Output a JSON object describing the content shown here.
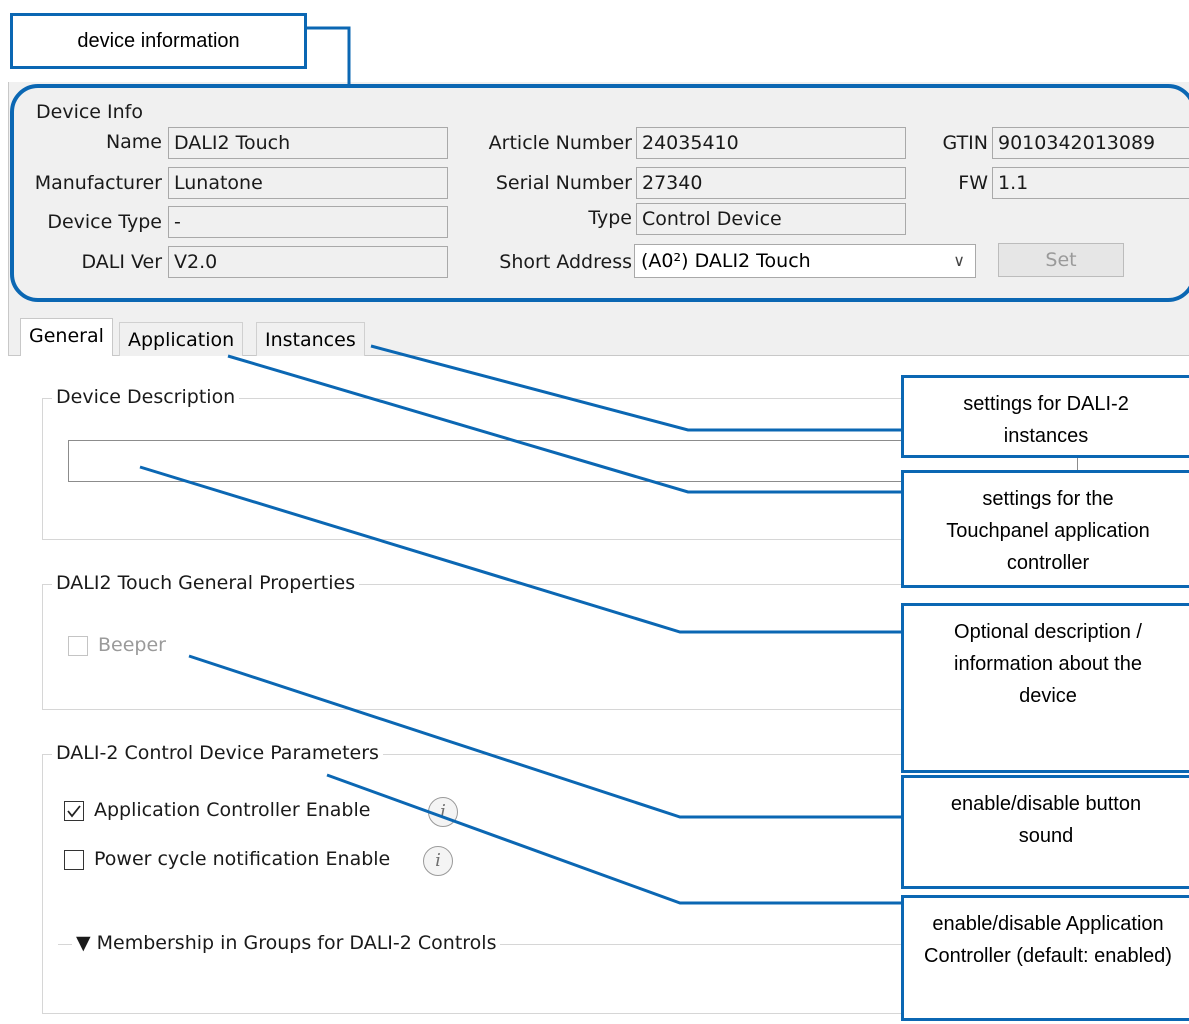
{
  "top_label": "device information",
  "device_info": {
    "group_title": "Device Info",
    "name_label": "Name",
    "name_value": "DALI2 Touch",
    "manufacturer_label": "Manufacturer",
    "manufacturer_value": "Lunatone",
    "device_type_label": "Device Type",
    "device_type_value": "-",
    "dali_ver_label": "DALI Ver",
    "dali_ver_value": "V2.0",
    "article_number_label": "Article Number",
    "article_number_value": "24035410",
    "serial_number_label": "Serial Number",
    "serial_number_value": "27340",
    "type_label": "Type",
    "type_value": "Control Device",
    "short_address_label": "Short Address",
    "short_address_value": "(A0²) DALI2 Touch",
    "gtin_label": "GTIN",
    "gtin_value": "9010342013089",
    "fw_label": "FW",
    "fw_value": "1.1",
    "set_button": "Set"
  },
  "tabs": [
    {
      "label": "General"
    },
    {
      "label": "Application"
    },
    {
      "label": "Instances"
    }
  ],
  "general": {
    "device_description_title": "Device Description",
    "device_description_value": "",
    "touch_props_title": "DALI2 Touch General Properties",
    "beeper_label": "Beeper",
    "beeper_checked": false,
    "control_params_title": "DALI-2 Control Device Parameters",
    "app_controller_label": "Application Controller Enable",
    "app_controller_checked": true,
    "power_cycle_label": "Power cycle notification Enable",
    "power_cycle_checked": false,
    "membership_label": "▼ Membership in Groups for DALI-2 Controls"
  },
  "callouts": {
    "instances": "settings for DALI-2 instances",
    "application": "settings for the Touchpanel application controller",
    "description": "Optional description / information about the device",
    "beeper": "enable/disable button sound",
    "app_controller": "enable/disable Application Controller (default: enabled)"
  },
  "icons": {
    "info": "info-icon",
    "dropdown": "chevron-down-icon",
    "checkmark": "checkmark-icon"
  },
  "colors": {
    "annotation_blue": "#0b67b3",
    "window_bg": "#f0f0f0"
  }
}
